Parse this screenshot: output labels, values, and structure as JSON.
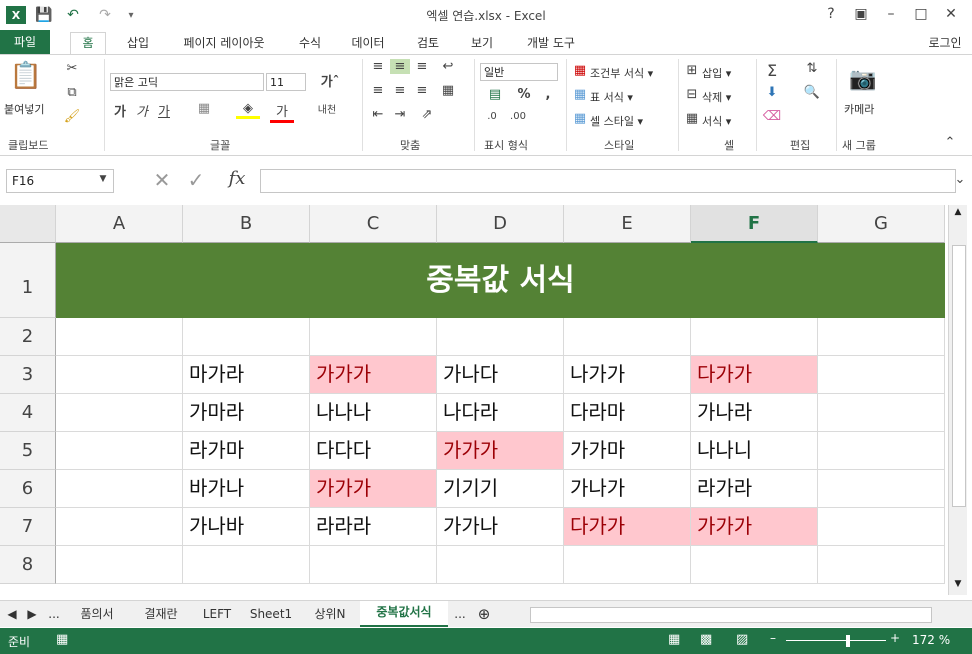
{
  "window": {
    "title": "엑셀 연습.xlsx - Excel",
    "help": "?",
    "restore_icon": "ribbon-display-icon",
    "minimize": "–",
    "maximize": "□",
    "close": "✕"
  },
  "ribbon_tabs": [
    "파일",
    "홈",
    "삽입",
    "페이지 레이아웃",
    "수식",
    "데이터",
    "검토",
    "보기",
    "개발 도구"
  ],
  "login": "로그인",
  "ribbon": {
    "clipboard": {
      "label": "클립보드",
      "paste": "붙여넣기"
    },
    "font": {
      "label": "글꼴",
      "font_name": "맑은 고딕",
      "font_size": "11"
    },
    "alignment": {
      "label": "맞춤"
    },
    "number": {
      "label": "표시 형식",
      "format": "일반"
    },
    "styles": {
      "label": "스타일",
      "conditional": "조건부 서식 ▾",
      "table": "표 서식 ▾",
      "cell_styles": "셀 스타일 ▾"
    },
    "cells": {
      "label": "셀",
      "insert": "삽입 ▾",
      "delete": "삭제 ▾",
      "format": "서식 ▾"
    },
    "editing": {
      "label": "편집"
    },
    "new_group": {
      "label": "새 그룹",
      "camera": "카메라"
    }
  },
  "formula_bar": {
    "name_box": "F16",
    "fx": "fx",
    "value": ""
  },
  "columns": [
    "A",
    "B",
    "C",
    "D",
    "E",
    "F",
    "G"
  ],
  "selected_column": "F",
  "rows": [
    "1",
    "2",
    "3",
    "4",
    "5",
    "6",
    "7",
    "8"
  ],
  "banner": "중복값 서식",
  "cells": {
    "r3": [
      "",
      "마가라",
      "가가가",
      "가나다",
      "나가가",
      "다가가",
      ""
    ],
    "r4": [
      "",
      "가마라",
      "나나나",
      "나다라",
      "다라마",
      "가나라",
      ""
    ],
    "r5": [
      "",
      "라가마",
      "다다다",
      "가가가",
      "가가마",
      "나나니",
      ""
    ],
    "r6": [
      "",
      "바가나",
      "가가가",
      "기기기",
      "가나가",
      "라가라",
      ""
    ],
    "r7": [
      "",
      "가나바",
      "라라라",
      "가가나",
      "다가가",
      "가가가",
      ""
    ]
  },
  "duplicates": {
    "r3": [
      2,
      5
    ],
    "r4": [],
    "r5": [
      3
    ],
    "r6": [
      2
    ],
    "r7": [
      4,
      5
    ]
  },
  "sheet_tabs": [
    "...",
    "품의서",
    "결재란",
    "LEFT",
    "Sheet1",
    "상위N",
    "중복값서식",
    "..."
  ],
  "active_sheet": "중복값서식",
  "status": {
    "ready": "준비",
    "zoom": "172 %"
  },
  "colors": {
    "excel_green": "#217346",
    "banner_green": "#548235",
    "dup_fill": "#ffc7ce",
    "dup_text": "#9c0006"
  }
}
